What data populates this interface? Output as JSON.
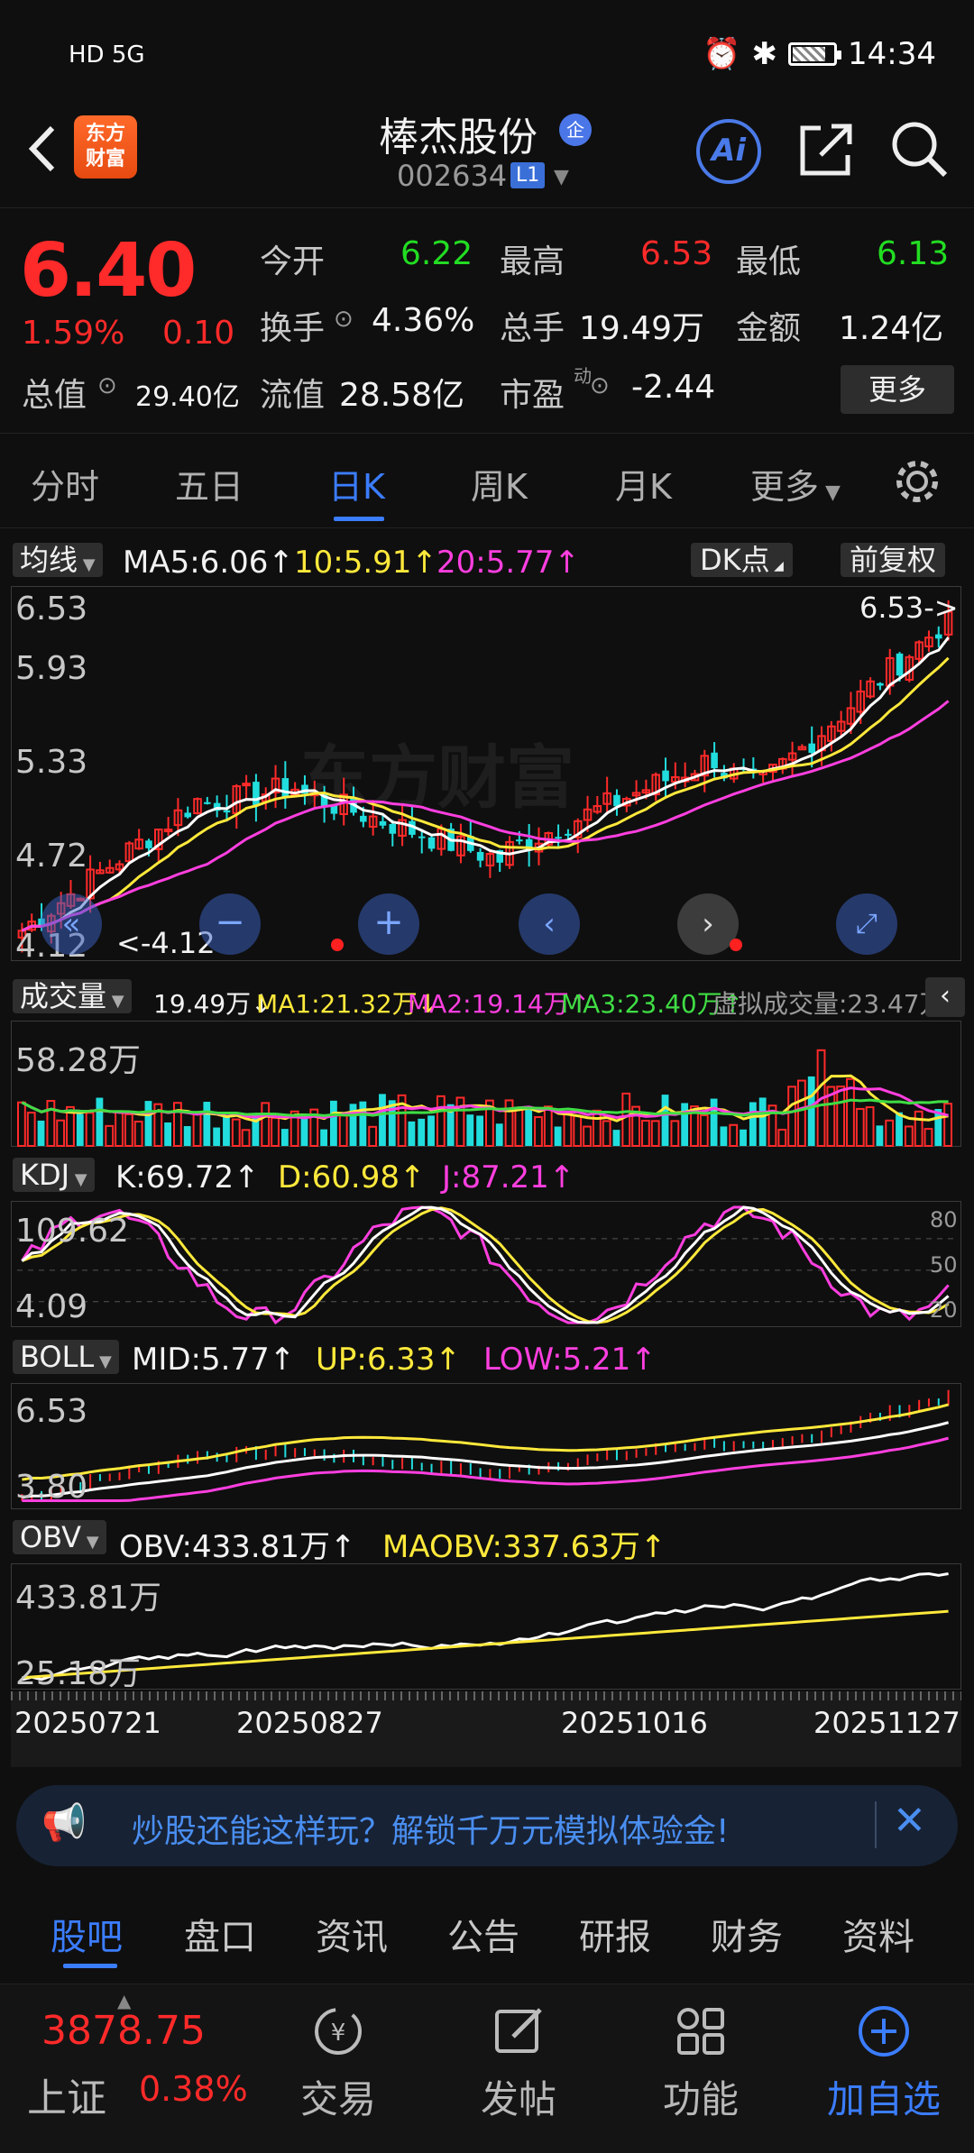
{
  "status_bar": {
    "left": "HD 5G",
    "time": "14:34"
  },
  "header": {
    "app_logo": "东方\n财富",
    "stock_name": "棒杰股份",
    "badge": "企",
    "stock_code": "002634",
    "level_badge": "L1",
    "ai_label": "Ai"
  },
  "quote": {
    "price": "6.40",
    "change_pct": "1.59%",
    "change_abs": "0.10",
    "open_label": "今开",
    "open": "6.22",
    "high_label": "最高",
    "high": "6.53",
    "low_label": "最低",
    "low": "6.13",
    "turnover_label": "换手",
    "turnover": "4.36%",
    "volume_label": "总手",
    "volume": "19.49万",
    "amount_label": "金额",
    "amount": "1.24亿",
    "mktcap_label": "总值",
    "mktcap": "29.40亿",
    "float_label": "流值",
    "float": "28.58亿",
    "pe_label": "市盈",
    "pe_sup": "动",
    "pe": "-2.44",
    "more": "更多"
  },
  "period_tabs": [
    "分时",
    "五日",
    "日K",
    "周K",
    "月K",
    "更多"
  ],
  "active_period": "日K",
  "ma_header": {
    "btn": "均线",
    "ma5": "MA5:6.06↑",
    "ma10": "10:5.91↑",
    "ma20": "20:5.77↑",
    "dk": "DK点",
    "adjust": "前复权"
  },
  "kline": {
    "ticks": [
      "6.53",
      "5.93",
      "5.33",
      "4.72",
      "4.12"
    ],
    "high_marker": "6.53->",
    "low_marker": "<-4.12",
    "watermark": "东方财富"
  },
  "volume_header": {
    "btn": "成交量",
    "vol": "19.49万↓",
    "ma1": "MA1:21.32万↓",
    "ma2": "MA2:19.14万↑",
    "ma3": "MA3:23.40万↑",
    "virtual": "虚拟成交量:23.47万",
    "max_label": "58.28万"
  },
  "kdj_header": {
    "btn": "KDJ",
    "k": "K:69.72↑",
    "d": "D:60.98↑",
    "j": "J:87.21↑",
    "top_label": "109.62",
    "bottom_label": "4.09",
    "levels": [
      "80",
      "50",
      "20"
    ]
  },
  "boll_header": {
    "btn": "BOLL",
    "mid": "MID:5.77↑",
    "up": "UP:6.33↑",
    "low": "LOW:5.21↑",
    "top_label": "6.53",
    "bottom_label": "3.80"
  },
  "obv_header": {
    "btn": "OBV",
    "obv": "OBV:433.81万↑",
    "maobv": "MAOBV:337.63万↑",
    "top_label": "433.81万",
    "bottom_label": "25.18万"
  },
  "dates": [
    "20250721",
    "20250827",
    "20251016",
    "20251127"
  ],
  "ad": {
    "text": "炒股还能这样玩？解锁千万元模拟体验金!"
  },
  "bottom_tabs": [
    "股吧",
    "盘口",
    "资讯",
    "公告",
    "研报",
    "财务",
    "资料"
  ],
  "active_bottom_tab": "股吧",
  "nav": {
    "index_value": "3878.75",
    "index_name": "上证",
    "index_change": "0.38%",
    "trade": "交易",
    "post": "发帖",
    "func": "功能",
    "add": "加自选"
  },
  "colors": {
    "up": "#ff2a2a",
    "down": "#22dddd",
    "accent": "#3b7dff",
    "ma5": "#ffffff",
    "ma10": "#ffe93b",
    "ma20": "#ff3fe0"
  }
}
